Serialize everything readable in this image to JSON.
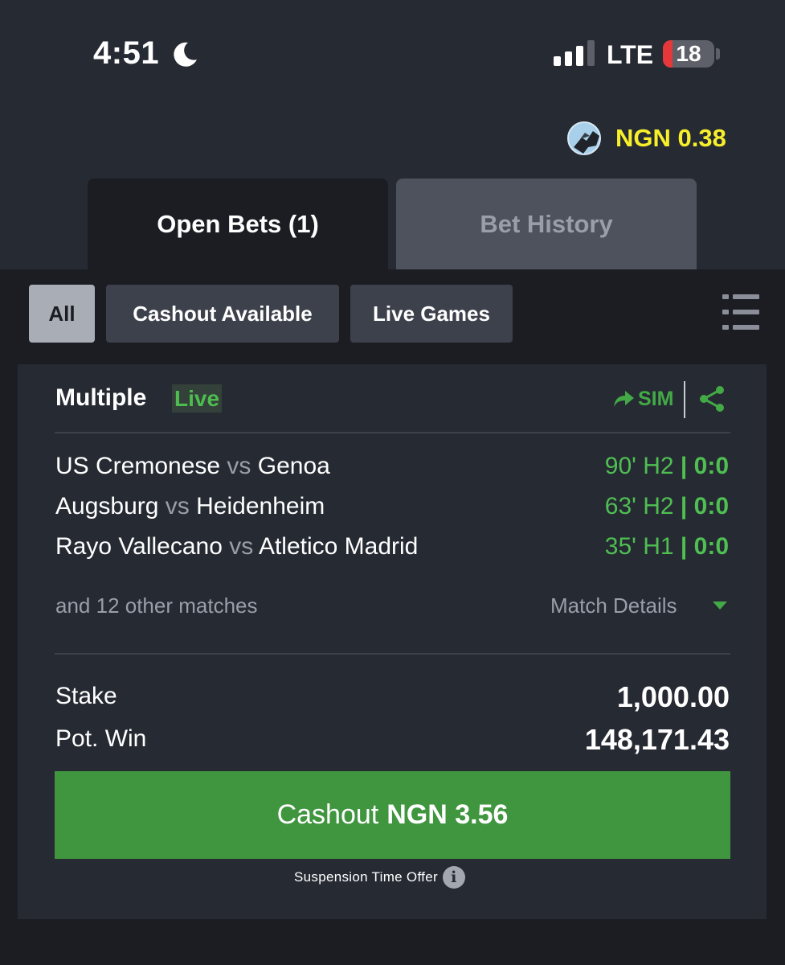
{
  "status_bar": {
    "time": "4:51",
    "network": "LTE",
    "battery": "18",
    "battery_level": 0.18,
    "signal_bars_active": 3,
    "icons": [
      "moon-icon",
      "signal-icon",
      "battery-icon"
    ]
  },
  "account": {
    "balance": "NGN 0.38",
    "balance_color": "#f7ef2a"
  },
  "tabs": [
    {
      "label": "Open Bets (1)",
      "active": true
    },
    {
      "label": "Bet History",
      "active": false
    }
  ],
  "filters": [
    {
      "label": "All",
      "selected": true
    },
    {
      "label": "Cashout Available",
      "selected": false
    },
    {
      "label": "Live Games",
      "selected": false
    }
  ],
  "bet": {
    "type": "Multiple",
    "live_badge": "Live",
    "sim_label": "SIM",
    "matches": [
      {
        "home": "US Cremonese",
        "vs": "vs",
        "away": "Genoa",
        "time": "90' H2",
        "score": "0:0"
      },
      {
        "home": "Augsburg",
        "vs": "vs",
        "away": "Heidenheim",
        "time": "63' H2",
        "score": "0:0"
      },
      {
        "home": "Rayo Vallecano",
        "vs": "vs",
        "away": "Atletico Madrid",
        "time": "35' H1",
        "score": "0:0"
      }
    ],
    "other_matches": "and 12 other matches",
    "match_details_label": "Match Details",
    "stake_label": "Stake",
    "stake": "1,000.00",
    "pot_win_label": "Pot. Win",
    "pot_win": "148,171.43",
    "cashout_label": "Cashout",
    "cashout_amount": "NGN 3.56",
    "suspension_text": "Suspension Time Offer"
  },
  "colors": {
    "accent_green": "#40953f",
    "live_green": "#4fbf52",
    "background": "#262a33",
    "panel": "#1b1d23"
  }
}
